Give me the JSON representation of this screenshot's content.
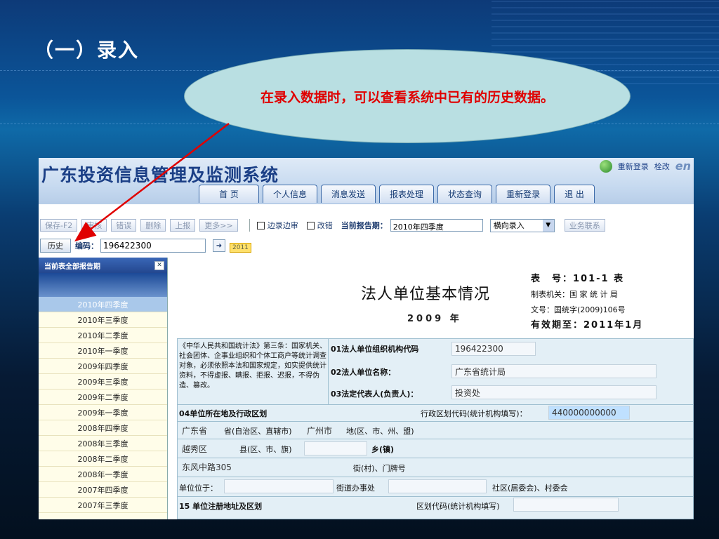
{
  "slide": {
    "title": "（一）录入",
    "callout": "在录入数据时，可以查看系统中已有的历史数据。"
  },
  "app": {
    "system_title": "广东投资信息管理及监测系统",
    "header_relogin": "重新登录",
    "header_ctrl_partial": "栓改",
    "brand_partial": "en",
    "nav": [
      "首 页",
      "个人信息",
      "消息发送",
      "报表处理",
      "状态查询",
      "重新登录",
      "退 出"
    ]
  },
  "toolbar": {
    "buttons": [
      "保存-F2",
      "审核",
      "错误",
      "删除",
      "上报",
      "更多>>"
    ],
    "check_audit": "边录边审",
    "check_correct": "改错",
    "period_label": "当前报告期：",
    "period_value": "2010年四季度",
    "mode_value": "横向录入",
    "business_partial": "业务联系"
  },
  "row2": {
    "history_button": "历史",
    "code_label": "编码：",
    "code_value": "196422300",
    "year_chip": "2011"
  },
  "sidebar": {
    "title": "当前表全部报告期",
    "close": "✕",
    "items": [
      "2010年四季度",
      "2010年三季度",
      "2010年二季度",
      "2010年一季度",
      "2009年四季度",
      "2009年三季度",
      "2009年二季度",
      "2009年一季度",
      "2008年四季度",
      "2008年三季度",
      "2008年二季度",
      "2008年一季度",
      "2007年四季度",
      "2007年三季度"
    ]
  },
  "form": {
    "title": "法人单位基本情况",
    "year": "2009 年",
    "meta_table_no": "表　号：101-1 表",
    "meta_org": "制表机关：国 家 统 计 局",
    "meta_doc": "文号：国统字(2009)106号",
    "meta_valid": "有效期至：2011年1月",
    "law_text": "《中华人民共和国统计法》第三条：国家机关、社会团体、企事业组织和个体工商户等统计调查对象，必须依照本法和国家规定，如实提供统计资料，不得虚报、瞒报、拒报、迟报，不得伪造、篡改。",
    "f01_label": "01法人单位组织机构代码",
    "f01_value": "196422300",
    "f02_label": "02法人单位名称：",
    "f02_value": "广东省统计局",
    "f03_label": "03法定代表人(负责人)：",
    "f03_value": "投资处",
    "f04_label": "04单位所在地及行政区划",
    "f04_code_label": "行政区划代码(统计机构填写)：",
    "f04_code_value": "440000000000",
    "prov": "广东省",
    "prov_suffix": "省(自治区、直辖市)",
    "city": "广州市",
    "city_suffix": "地(区、市、州、盟)",
    "county": "越秀区",
    "county_suffix": "县(区、市、旗)",
    "town_suffix": "乡(镇)",
    "street": "东风中路305",
    "street_suffix": "街(村)、门牌号",
    "located_label": "单位位于：",
    "subdistrict_suffix": "街道办事处",
    "community_suffix": "社区(居委会)、村委会",
    "f15_label": "15 单位注册地址及区划",
    "f15_code_label": "区划代码(统计机构填写)"
  },
  "colors": {
    "callout_text": "#e00000",
    "arrow": "#e00000",
    "title_blue": "#1b3f86"
  }
}
